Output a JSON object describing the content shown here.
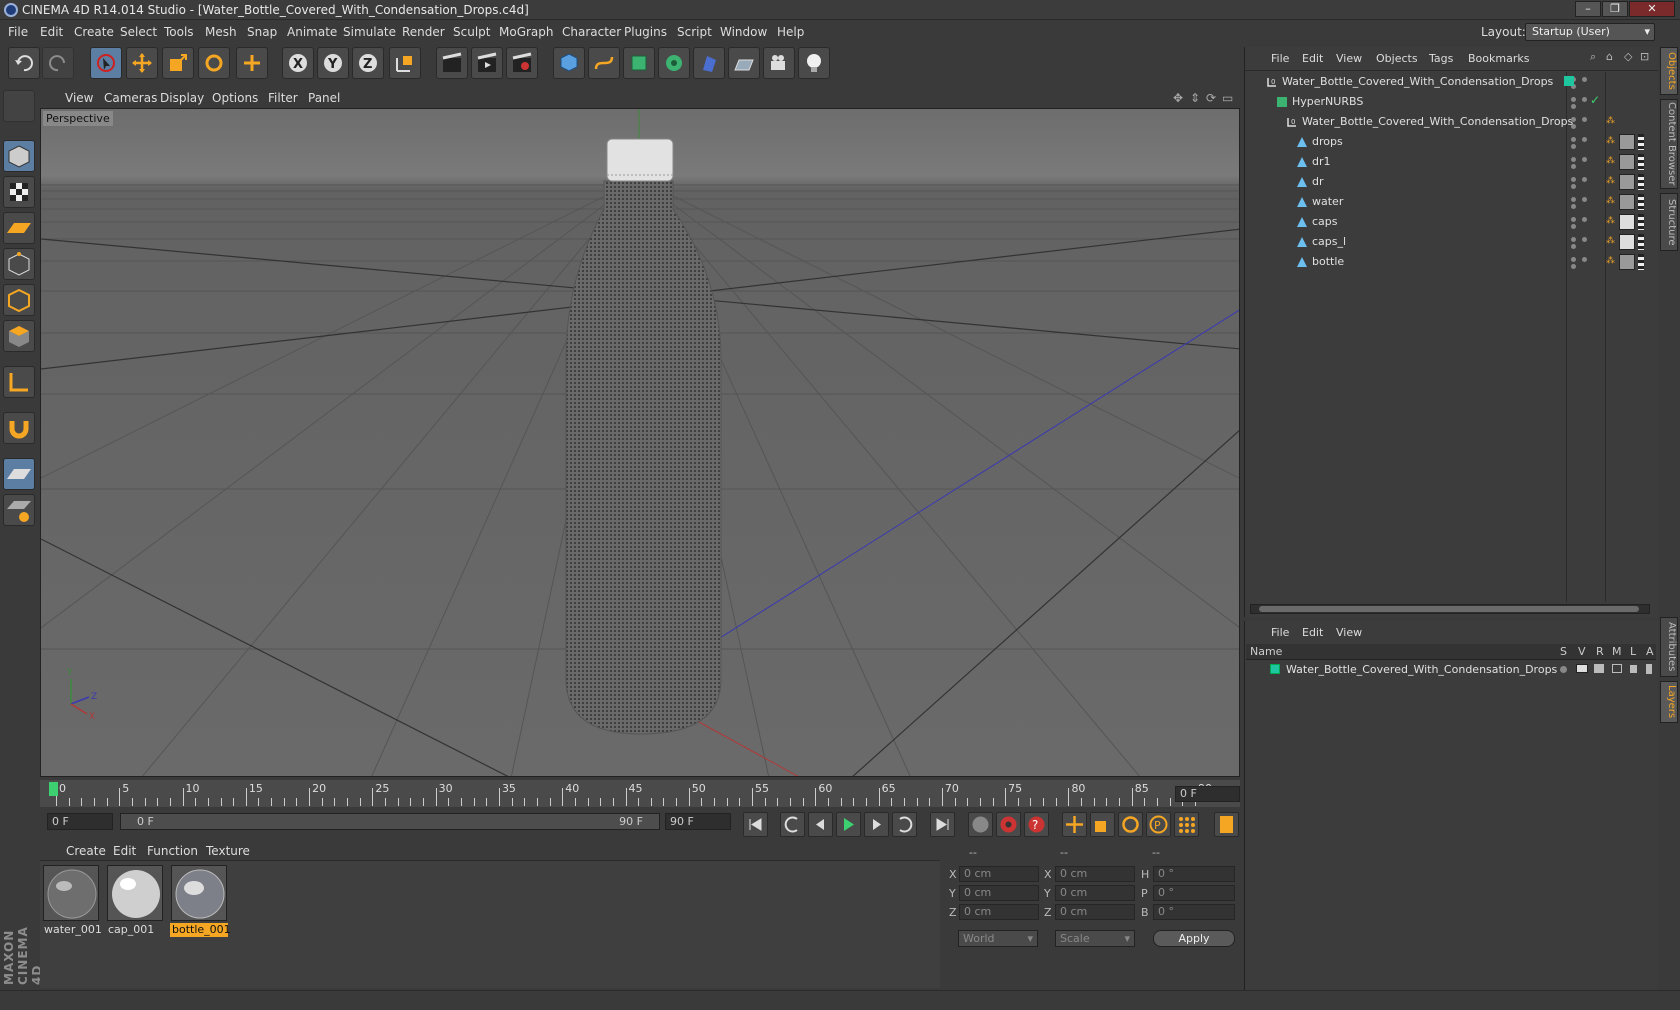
{
  "window": {
    "title": "CINEMA 4D R14.014 Studio - [Water_Bottle_Covered_With_Condensation_Drops.c4d]"
  },
  "menu": [
    "File",
    "Edit",
    "Create",
    "Select",
    "Tools",
    "Mesh",
    "Snap",
    "Animate",
    "Simulate",
    "Render",
    "Sculpt",
    "MoGraph",
    "Character",
    "Plugins",
    "Script",
    "Window",
    "Help"
  ],
  "layout": {
    "label": "Layout:",
    "value": "Startup (User)"
  },
  "viewport": {
    "menu": [
      "View",
      "Cameras",
      "Display",
      "Options",
      "Filter",
      "Panel"
    ],
    "label": "Perspective"
  },
  "timeline": {
    "ticks": [
      "0",
      "5",
      "10",
      "15",
      "20",
      "25",
      "30",
      "35",
      "40",
      "45",
      "50",
      "55",
      "60",
      "65",
      "70",
      "75",
      "80",
      "85",
      "90"
    ],
    "current_frame": "0 F",
    "start": "0 F",
    "range_start": "0 F",
    "range_end": "90 F",
    "end": "90 F"
  },
  "materials": {
    "menu": [
      "Create",
      "Edit",
      "Function",
      "Texture"
    ],
    "items": [
      {
        "name": "water_001",
        "selected": false
      },
      {
        "name": "cap_001",
        "selected": false
      },
      {
        "name": "bottle_001",
        "selected": true
      }
    ]
  },
  "coordinates": {
    "headers": [
      "--",
      "--",
      "--"
    ],
    "rows": [
      {
        "a": "X",
        "pos": "0 cm",
        "b": "X",
        "size": "0 cm",
        "c": "H",
        "rot": "0 °"
      },
      {
        "a": "Y",
        "pos": "0 cm",
        "b": "Y",
        "size": "0 cm",
        "c": "P",
        "rot": "0 °"
      },
      {
        "a": "Z",
        "pos": "0 cm",
        "b": "Z",
        "size": "0 cm",
        "c": "B",
        "rot": "0 °"
      }
    ],
    "mode1": "World",
    "mode2": "Scale",
    "apply": "Apply"
  },
  "objects": {
    "menu": [
      "File",
      "Edit",
      "View",
      "Objects",
      "Tags",
      "Bookmarks"
    ],
    "tree": [
      {
        "name": "Water_Bottle_Covered_With_Condensation_Drops",
        "type": "null"
      },
      {
        "name": "HyperNURBS",
        "type": "hypernurbs"
      },
      {
        "name": "Water_Bottle_Covered_With_Condensation_Drops",
        "type": "null"
      },
      {
        "name": "drops",
        "type": "poly"
      },
      {
        "name": "dr1",
        "type": "poly"
      },
      {
        "name": "dr",
        "type": "poly"
      },
      {
        "name": "water",
        "type": "poly"
      },
      {
        "name": "caps",
        "type": "poly"
      },
      {
        "name": "caps_l",
        "type": "poly"
      },
      {
        "name": "bottle",
        "type": "poly"
      }
    ]
  },
  "layers": {
    "menu": [
      "File",
      "Edit",
      "View"
    ],
    "columns": [
      "Name",
      "S",
      "V",
      "R",
      "M",
      "L",
      "A"
    ],
    "rows": [
      {
        "name": "Water_Bottle_Covered_With_Condensation_Drops",
        "color": "#1fc7a0"
      }
    ]
  },
  "sidetabs": [
    "Objects",
    "Content Browser",
    "Structure",
    "Attributes",
    "Layers"
  ],
  "branding": "MAXON CINEMA 4D",
  "colors": {
    "accent": "#f5a623",
    "selected_tool": "#5d7ea3",
    "layer": "#1fc7a0"
  }
}
